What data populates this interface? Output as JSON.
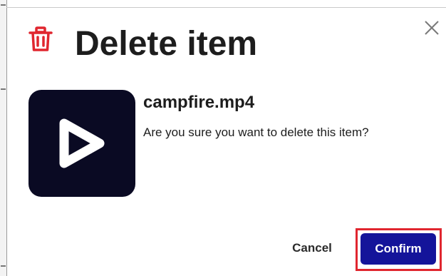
{
  "dialog": {
    "title": "Delete item",
    "close_icon": "close-icon",
    "trash_icon": "trash-icon"
  },
  "item": {
    "filename": "campfire.mp4",
    "thumbnail_icon": "play-icon",
    "message": "Are you sure you want to delete this item?"
  },
  "actions": {
    "cancel_label": "Cancel",
    "confirm_label": "Confirm"
  },
  "colors": {
    "danger": "#e0262f",
    "primary": "#14149a",
    "thumbnail_bg": "#0a0a23",
    "text": "#1d1d1d"
  }
}
